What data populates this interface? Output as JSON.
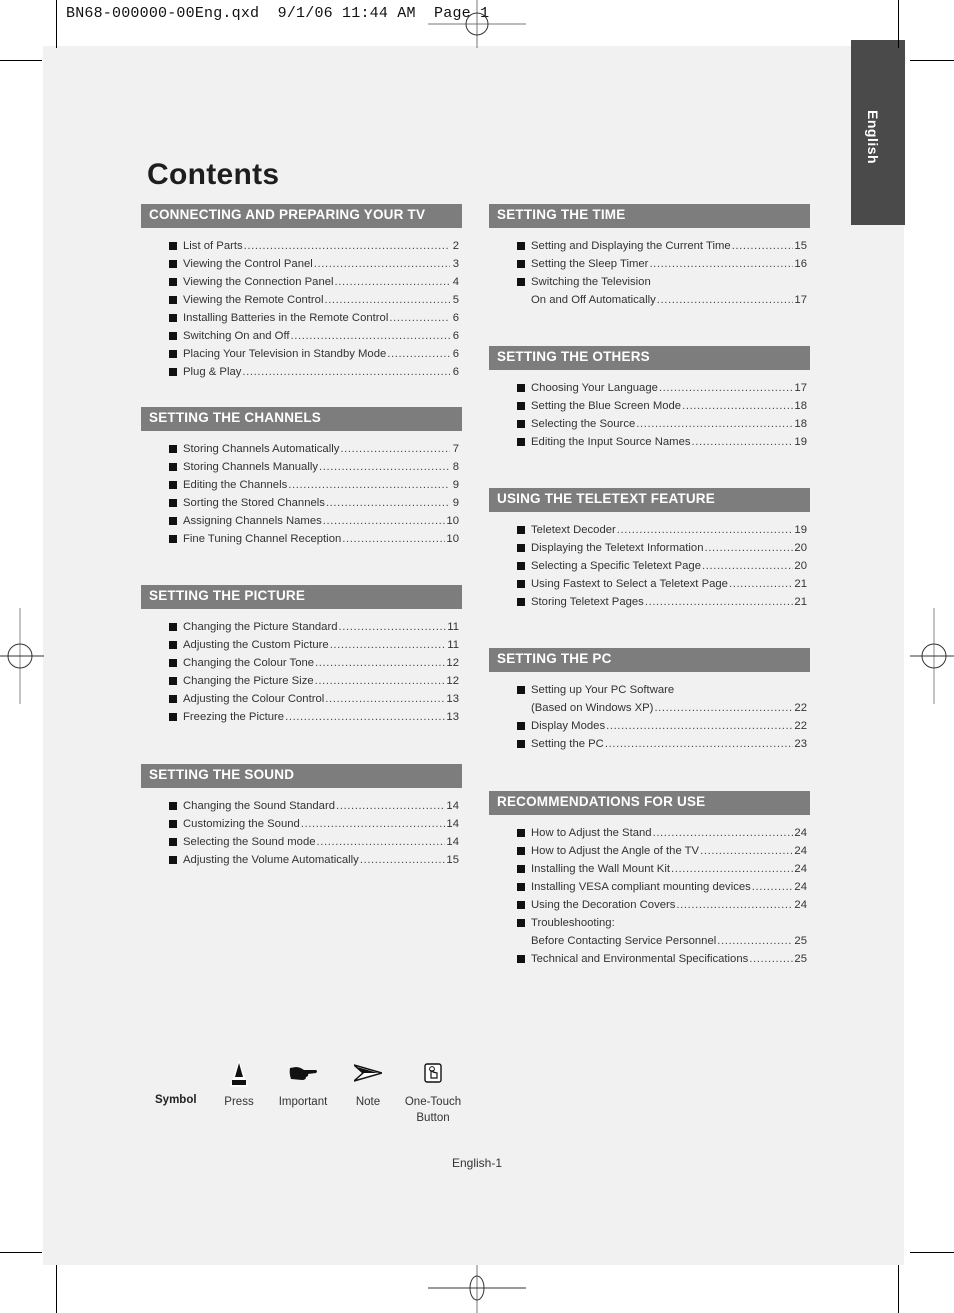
{
  "slug": "BN68-000000-00Eng.qxd  9/1/06 11:44 AM  Page 1",
  "language_tab": "English",
  "title": "Contents",
  "sections": [
    {
      "heading": "CONNECTING AND PREPARING YOUR TV",
      "items": [
        {
          "label": "List of Parts",
          "page": "2"
        },
        {
          "label": "Viewing the Control Panel",
          "page": "3"
        },
        {
          "label": "Viewing the Connection Panel",
          "page": "4"
        },
        {
          "label": "Viewing the Remote Control",
          "page": "5"
        },
        {
          "label": "Installing Batteries in the Remote Control",
          "page": "6"
        },
        {
          "label": "Switching On and Off",
          "page": "6"
        },
        {
          "label": "Placing Your Television in Standby Mode",
          "page": "6"
        },
        {
          "label": "Plug & Play",
          "page": "6"
        }
      ]
    },
    {
      "heading": "SETTING THE CHANNELS",
      "items": [
        {
          "label": "Storing Channels Automatically",
          "page": "7"
        },
        {
          "label": "Storing Channels Manually",
          "page": "8"
        },
        {
          "label": "Editing the Channels",
          "page": "9"
        },
        {
          "label": "Sorting the Stored Channels",
          "page": "9"
        },
        {
          "label": "Assigning Channels Names",
          "page": "10"
        },
        {
          "label": "Fine Tuning Channel Reception",
          "page": "10"
        }
      ]
    },
    {
      "heading": "SETTING THE PICTURE",
      "items": [
        {
          "label": "Changing the Picture Standard",
          "page": "11"
        },
        {
          "label": "Adjusting the Custom Picture",
          "page": "11"
        },
        {
          "label": "Changing the Colour Tone",
          "page": "12"
        },
        {
          "label": "Changing the Picture Size",
          "page": "12"
        },
        {
          "label": "Adjusting the Colour Control",
          "page": "13"
        },
        {
          "label": "Freezing the Picture",
          "page": "13"
        }
      ]
    },
    {
      "heading": "SETTING THE SOUND",
      "items": [
        {
          "label": "Changing the Sound Standard",
          "page": "14"
        },
        {
          "label": "Customizing the Sound",
          "page": "14"
        },
        {
          "label": "Selecting the Sound mode",
          "page": "14"
        },
        {
          "label": "Adjusting the Volume Automatically",
          "page": "15"
        }
      ]
    },
    {
      "heading": "SETTING THE TIME",
      "items": [
        {
          "label": "Setting and Displaying the Current Time",
          "page": "15"
        },
        {
          "label": "Setting the Sleep Timer",
          "page": "16"
        },
        {
          "first_line": "Switching the Television",
          "label": "On and Off Automatically",
          "page": "17"
        }
      ]
    },
    {
      "heading": "SETTING THE OTHERS",
      "items": [
        {
          "label": "Choosing Your Language",
          "page": "17"
        },
        {
          "label": "Setting the Blue Screen Mode",
          "page": "18"
        },
        {
          "label": "Selecting the Source",
          "page": "18"
        },
        {
          "label": "Editing the Input Source Names",
          "page": "19"
        }
      ]
    },
    {
      "heading": "USING THE TELETEXT FEATURE",
      "items": [
        {
          "label": "Teletext Decoder",
          "page": "19"
        },
        {
          "label": "Displaying the Teletext Information",
          "page": "20"
        },
        {
          "label": "Selecting a Specific Teletext Page",
          "page": "20"
        },
        {
          "label": "Using Fastext to Select a Teletext Page",
          "page": "21"
        },
        {
          "label": "Storing Teletext Pages",
          "page": "21"
        }
      ]
    },
    {
      "heading": "SETTING THE PC",
      "items": [
        {
          "first_line": "Setting up Your PC Software",
          "label": "(Based on Windows XP)",
          "page": "22"
        },
        {
          "label": "Display Modes",
          "page": "22"
        },
        {
          "label": "Setting the PC",
          "page": "23"
        }
      ]
    },
    {
      "heading": "RECOMMENDATIONS FOR USE",
      "items": [
        {
          "label": "How to Adjust the Stand",
          "page": "24"
        },
        {
          "label": "How to Adjust the Angle of the TV",
          "page": "24"
        },
        {
          "label": "Installing the Wall Mount Kit",
          "page": "24"
        },
        {
          "label": "Installing VESA compliant mounting devices",
          "page": "24"
        },
        {
          "label": "Using the Decoration Covers",
          "page": "24"
        },
        {
          "first_line": "Troubleshooting:",
          "label": "Before Contacting Service Personnel",
          "page": "25"
        },
        {
          "label": "Technical and Environmental Specifications",
          "page": "25"
        }
      ]
    }
  ],
  "symbols": {
    "heading": "Symbol",
    "items": [
      {
        "icon": "press-icon",
        "caption": "Press"
      },
      {
        "icon": "pointing-hand-icon",
        "caption": "Important"
      },
      {
        "icon": "note-arrow-icon",
        "caption": "Note"
      },
      {
        "icon": "one-touch-button-icon",
        "caption": "One-Touch\nButton"
      }
    ]
  },
  "footer": "English-1",
  "colors": {
    "page_background": "#f1f1f1",
    "section_header": "#7d7d7d",
    "language_tab": "#4a4a4a"
  }
}
